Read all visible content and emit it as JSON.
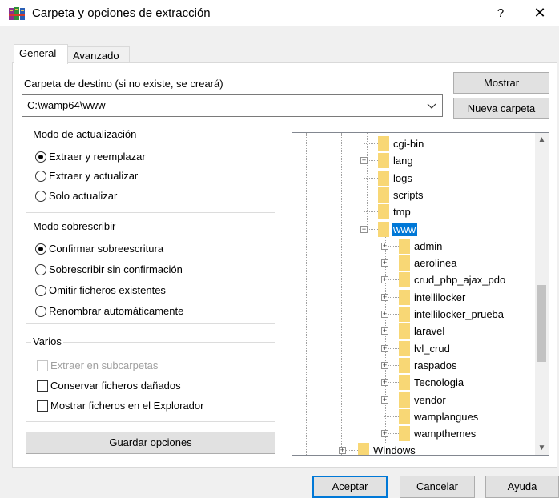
{
  "window": {
    "title": "Carpeta y opciones de extracción",
    "help": "?",
    "close": "✕"
  },
  "tabs": [
    {
      "label": "General",
      "active": true
    },
    {
      "label": "Avanzado",
      "active": false
    }
  ],
  "destination": {
    "label": "Carpeta de destino (si no existe, se creará)",
    "value": "C:\\wamp64\\www",
    "show_button": "Mostrar",
    "new_folder_button": "Nueva carpeta"
  },
  "update_mode": {
    "title": "Modo de actualización",
    "options": [
      {
        "label": "Extraer y reemplazar",
        "selected": true
      },
      {
        "label": "Extraer y actualizar",
        "selected": false
      },
      {
        "label": "Solo actualizar",
        "selected": false
      }
    ]
  },
  "overwrite_mode": {
    "title": "Modo sobrescribir",
    "options": [
      {
        "label": "Confirmar sobreescritura",
        "selected": true
      },
      {
        "label": "Sobrescribir sin confirmación",
        "selected": false
      },
      {
        "label": "Omitir ficheros existentes",
        "selected": false
      },
      {
        "label": "Renombrar automáticamente",
        "selected": false
      }
    ]
  },
  "misc": {
    "title": "Varios",
    "options": [
      {
        "label": "Extraer en subcarpetas",
        "checked": false,
        "disabled": true
      },
      {
        "label": "Conservar ficheros dañados",
        "checked": false,
        "disabled": false
      },
      {
        "label": "Mostrar ficheros en el Explorador",
        "checked": false,
        "disabled": false
      }
    ]
  },
  "save_options": "Guardar opciones",
  "tree": {
    "items": [
      {
        "label": "cgi-bin",
        "expander": false,
        "selected": false
      },
      {
        "label": "lang",
        "expander": true,
        "selected": false
      },
      {
        "label": "logs",
        "expander": false,
        "selected": false
      },
      {
        "label": "scripts",
        "expander": false,
        "selected": false
      },
      {
        "label": "tmp",
        "expander": false,
        "selected": false
      },
      {
        "label": "www",
        "expander": true,
        "selected": true
      },
      {
        "label": "admin",
        "expander": true,
        "selected": false
      },
      {
        "label": "aerolinea",
        "expander": true,
        "selected": false
      },
      {
        "label": "crud_php_ajax_pdo",
        "expander": true,
        "selected": false
      },
      {
        "label": "intellilocker",
        "expander": true,
        "selected": false
      },
      {
        "label": "intellilocker_prueba",
        "expander": true,
        "selected": false
      },
      {
        "label": "laravel",
        "expander": true,
        "selected": false
      },
      {
        "label": "lvl_crud",
        "expander": true,
        "selected": false
      },
      {
        "label": "raspados",
        "expander": true,
        "selected": false
      },
      {
        "label": "Tecnologia",
        "expander": true,
        "selected": false
      },
      {
        "label": "vendor",
        "expander": true,
        "selected": false
      },
      {
        "label": "wamplangues",
        "expander": false,
        "selected": false
      },
      {
        "label": "wampthemes",
        "expander": true,
        "selected": false
      },
      {
        "label": "Windows",
        "expander": true,
        "selected": false
      }
    ]
  },
  "footer": {
    "accept": "Aceptar",
    "cancel": "Cancelar",
    "help": "Ayuda"
  },
  "colors": {
    "accent": "#0078d7",
    "folder": "#f8d775"
  }
}
